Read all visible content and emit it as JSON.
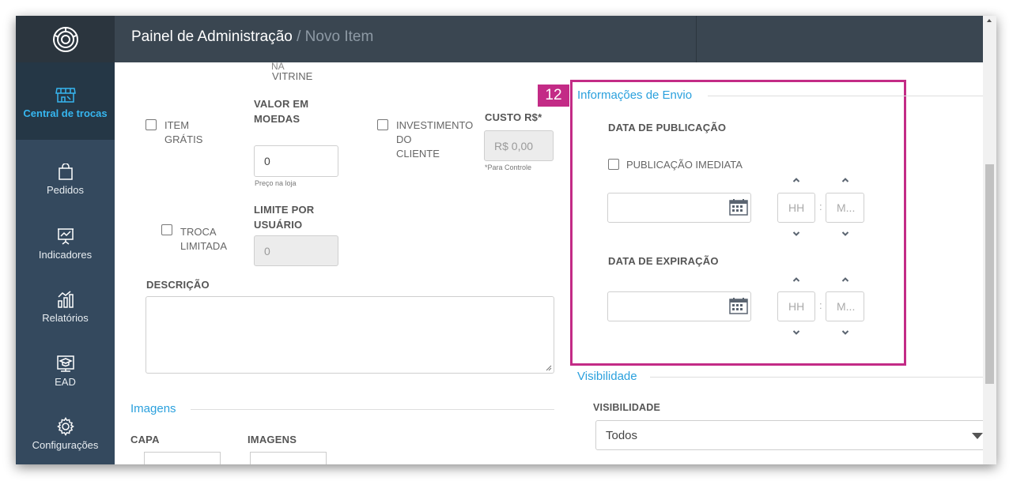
{
  "header": {
    "title": "Painel de Administração",
    "crumb": " / Novo Item"
  },
  "sidebar": {
    "items": [
      {
        "label": "Central de trocas",
        "icon": "store-icon",
        "active": true
      },
      {
        "label": "Pedidos",
        "icon": "shopping-bag-icon",
        "active": false
      },
      {
        "label": "Indicadores",
        "icon": "presentation-chart-icon",
        "active": false
      },
      {
        "label": "Relatórios",
        "icon": "bar-chart-icon",
        "active": false
      },
      {
        "label": "EAD",
        "icon": "graduation-cap-icon",
        "active": false
      },
      {
        "label": "Configurações",
        "icon": "gear-icon",
        "active": false
      }
    ]
  },
  "form": {
    "vitrine_cut": "NA",
    "vitrine": "VITRINE",
    "item_gratis": "ITEM\nGRÁTIS",
    "valor_em_moedas_label": "VALOR EM\nMOEDAS",
    "valor_em_moedas_value": "0",
    "preco_na_loja": "Preço na loja",
    "investimento": "INVESTIMENTO\nDO\nCLIENTE",
    "custo_label": "CUSTO R$*",
    "custo_value": "R$ 0,00",
    "para_controle": "*Para Controle",
    "troca_limitada": "TROCA\nLIMITADA",
    "limite_label": "LIMITE POR\nUSUÁRIO",
    "limite_value": "0",
    "descricao_label": "DESCRIÇÃO",
    "descricao_value": ""
  },
  "imagens": {
    "section_title": "Imagens",
    "capa_label": "CAPA",
    "imagens_label": "IMAGENS"
  },
  "envio": {
    "badge": "12",
    "section_title": "Informações de Envio",
    "data_publicacao_label": "DATA DE PUBLICAÇÃO",
    "publicacao_imediata": "PUBLICAÇÃO IMEDIATA",
    "pub_date_value": "",
    "pub_hour_placeholder": "HH",
    "pub_min_placeholder": "M...",
    "separator": ":",
    "data_expiracao_label": "DATA DE EXPIRAÇÃO",
    "exp_date_value": "",
    "exp_hour_placeholder": "HH",
    "exp_min_placeholder": "M..."
  },
  "visibilidade": {
    "section_title": "Visibilidade",
    "label": "VISIBILIDADE",
    "selected": "Todos"
  },
  "colors": {
    "topbar": "#3a4651",
    "sidebar": "#34495e",
    "accent": "#2aa0dd",
    "highlight": "#c32b86"
  }
}
